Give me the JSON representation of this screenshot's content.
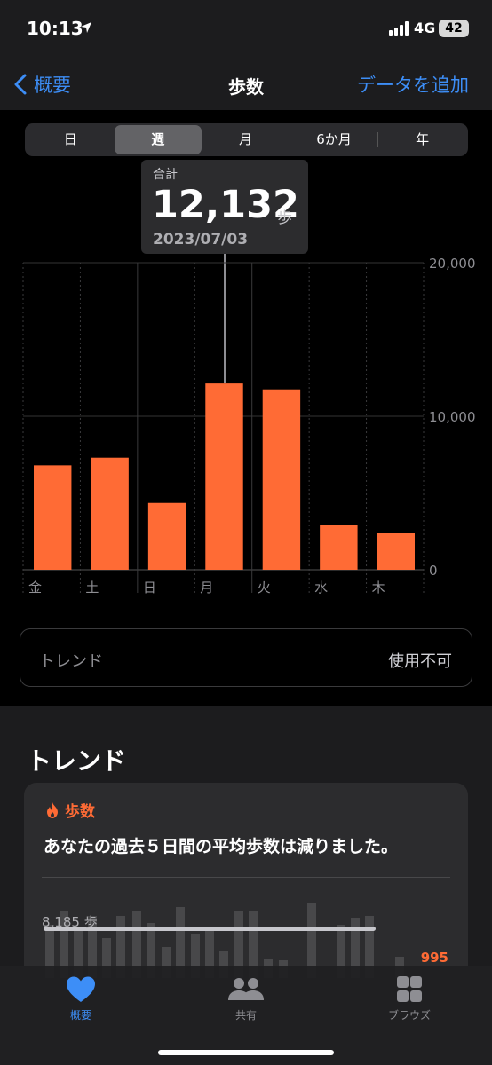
{
  "status": {
    "time": "10:13",
    "network": "4G",
    "battery": "42"
  },
  "nav": {
    "back_label": "概要",
    "title": "歩数",
    "add_label": "データを追加"
  },
  "segments": [
    {
      "label": "日",
      "active": false
    },
    {
      "label": "週",
      "active": true
    },
    {
      "label": "月",
      "active": false
    },
    {
      "label": "6か月",
      "active": false
    },
    {
      "label": "年",
      "active": false
    }
  ],
  "tooltip": {
    "label": "合計",
    "value": "12,132",
    "unit": "歩",
    "date": "2023/07/03"
  },
  "chart_data": {
    "type": "bar",
    "categories": [
      "金",
      "土",
      "日",
      "月",
      "火",
      "水",
      "木"
    ],
    "values": [
      6800,
      7300,
      4350,
      12132,
      11750,
      2900,
      2400
    ],
    "ylim": [
      0,
      20000
    ],
    "yticks": [
      "20,000",
      "10,000",
      "0"
    ],
    "color": "#ff6b35",
    "grid": true
  },
  "trend_row": {
    "label": "トレンド",
    "value": "使用不可"
  },
  "trends": {
    "heading": "トレンド",
    "card": {
      "category_icon": "flame-icon",
      "category": "歩数",
      "message": "あなたの過去５日間の平均歩数は減りました。",
      "average_label": "8,185 歩",
      "latest_value": "995"
    }
  },
  "tabs": [
    {
      "label": "概要",
      "icon": "heart-icon",
      "active": true
    },
    {
      "label": "共有",
      "icon": "people-icon",
      "active": false
    },
    {
      "label": "ブラウズ",
      "icon": "grid-icon",
      "active": false
    }
  ]
}
